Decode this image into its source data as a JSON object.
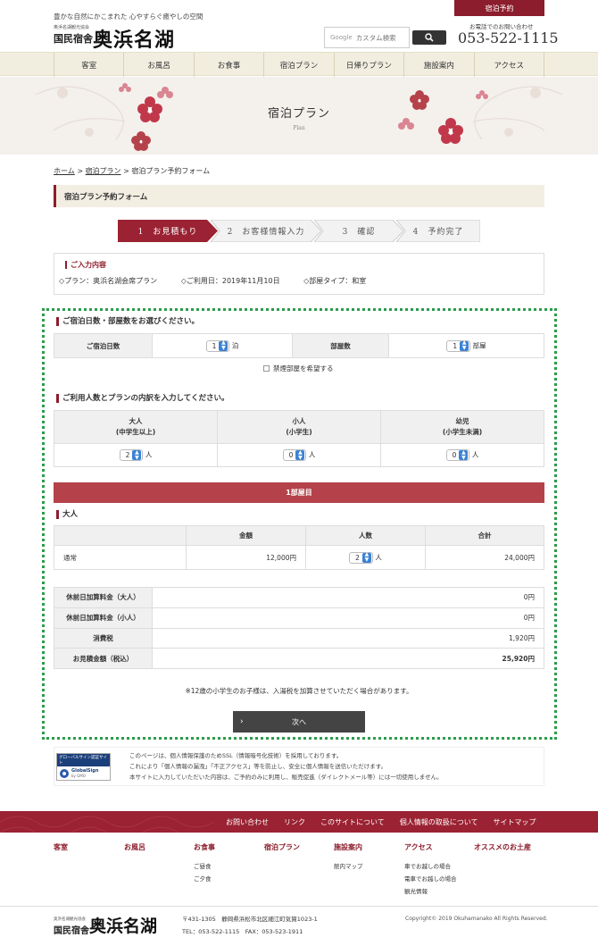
{
  "header": {
    "tagline": "豊かな自然にかこまれた 心やすらぐ癒やしの空間",
    "logo_small": "奥浜名湖観光協会",
    "logo_main": "国民宿舎",
    "logo_brush": "奥浜名湖",
    "search_google": "Google",
    "search_placeholder": "カスタム検索",
    "reserve_label": "宿泊予約",
    "phone_label": "お電話でのお問い合わせ",
    "phone": "053-522-1115"
  },
  "nav": [
    "客室",
    "お風呂",
    "お食事",
    "宿泊プラン",
    "日帰りプラン",
    "施設案内",
    "アクセス"
  ],
  "hero": {
    "title": "宿泊プラン",
    "subtitle": "Plan"
  },
  "breadcrumb": {
    "home": "ホーム",
    "sep": ">",
    "plan": "宿泊プラン",
    "current": "宿泊プラン予約フォーム"
  },
  "form_title": "宿泊プラン予約フォーム",
  "steps": [
    {
      "num": "1",
      "label": "お見積もり"
    },
    {
      "num": "2",
      "label": "お客様情報入力"
    },
    {
      "num": "3",
      "label": "確認"
    },
    {
      "num": "4",
      "label": "予約完了"
    }
  ],
  "input_info": {
    "title": "ご入力内容",
    "plan": "◇プラン：奥浜名湖会席プラン",
    "date": "◇ご利用日：2019年11月10日",
    "room_type": "◇部屋タイプ：和室"
  },
  "stay": {
    "title": "ご宿泊日数・部屋数をお選びください。",
    "nights_label": "ご宿泊日数",
    "nights_value": "1",
    "nights_unit": "泊",
    "rooms_label": "部屋数",
    "rooms_value": "1",
    "rooms_unit": "部屋",
    "nosmoking_label": "禁煙部屋を希望する"
  },
  "guests": {
    "title": "ご利用人数とプランの内訳を入力してください。",
    "cols": [
      {
        "label": "大人",
        "sub": "(中学生以上)",
        "value": "2",
        "unit": "人"
      },
      {
        "label": "小人",
        "sub": "(小学生)",
        "value": "0",
        "unit": "人"
      },
      {
        "label": "幼児",
        "sub": "(小学生未満)",
        "value": "0",
        "unit": "人"
      }
    ]
  },
  "room1": {
    "bar": "1部屋目",
    "section": "大人",
    "headers": [
      "",
      "金額",
      "人数",
      "合計"
    ],
    "row": {
      "name": "通常",
      "price": "12,000円",
      "count": "2",
      "unit": "人",
      "total": "24,000円"
    }
  },
  "summary": [
    {
      "label": "休前日加算料金（大人）",
      "value": "0円"
    },
    {
      "label": "休前日加算料金（小人）",
      "value": "0円"
    },
    {
      "label": "消費税",
      "value": "1,920円"
    },
    {
      "label": "お見積金額（税込）",
      "value": "25,920円"
    }
  ],
  "note": "※12歳の小学生のお子様は、入湯税を加算させていただく場合があります。",
  "next_label": "次へ",
  "ssl": {
    "badge_title": "グローバルサイン認証サイト",
    "badge_name": "GlobalSign",
    "badge_sub": "by GMO",
    "lines": [
      "このページは、個人情報保護のためSSL（情報暗号化技術）を採用しております。",
      "これにより「個人情報の漏洩」「不正アクセス」等を防止し、安全に個人情報を送信いただけます。",
      "本サイトに入力していただいた内容は、ご予約のみに利用し、販売促進（ダイレクトメール等）には一切使用しません。"
    ]
  },
  "footer": {
    "links": [
      "お問い合わせ",
      "リンク",
      "このサイトについて",
      "個人情報の取扱について",
      "サイトマップ"
    ],
    "cats": [
      {
        "label": "客室",
        "subs": []
      },
      {
        "label": "お風呂",
        "subs": []
      },
      {
        "label": "お食事",
        "subs": [
          "ご昼食",
          "ご夕食"
        ]
      },
      {
        "label": "宿泊プラン",
        "subs": []
      },
      {
        "label": "施設案内",
        "subs": [
          "館内マップ"
        ]
      },
      {
        "label": "アクセス",
        "subs": [
          "車でお越しの場合",
          "電車でお越しの場合",
          "観光情報"
        ]
      },
      {
        "label": "オススメのお土産",
        "subs": []
      }
    ],
    "logo_small": "奥浜名湖観光協会",
    "logo_main": "国民宿舎",
    "logo_brush": "奥浜名湖",
    "address": "〒431-1305　静岡県浜松市北区細江町気賀1023-1",
    "tel": "TEL：053-522-1115　FAX：053-523-1911",
    "copyright": "Copyright© 2019 Okuhamanako All Rights Reserved."
  },
  "colors": {
    "accent": "#8c1d2c",
    "room_bar": "#b5424a",
    "dotted": "#2a9d4a"
  }
}
